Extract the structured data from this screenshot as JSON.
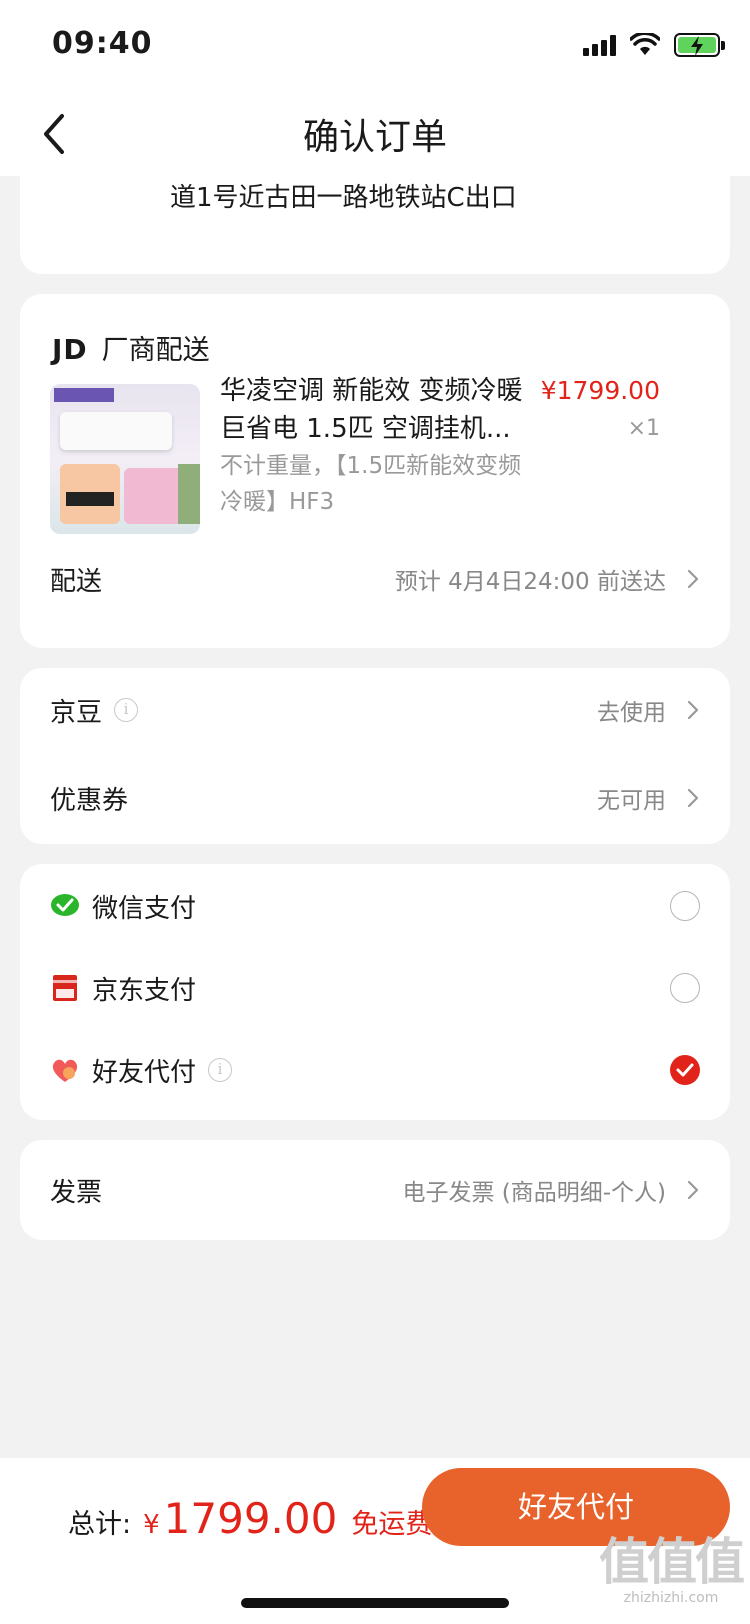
{
  "status_bar": {
    "time": "09:40"
  },
  "nav": {
    "title": "确认订单"
  },
  "address": {
    "text": "道1号近古田一路地铁站C出口"
  },
  "shop": {
    "logo": "JD",
    "name": "厂商配送"
  },
  "product": {
    "title": "华凌空调 新能效 变频冷暖巨省电 1.5匹 空调挂机...",
    "price": "¥1799.00",
    "quantity": "×1",
    "spec": "不计重量，【1.5匹新能效变频冷暖】HF3"
  },
  "delivery": {
    "label": "配送",
    "value": "预计 4月4日24:00 前送达"
  },
  "discounts": {
    "beans": {
      "label": "京豆",
      "value": "去使用"
    },
    "coupon": {
      "label": "优惠券",
      "value": "无可用"
    }
  },
  "payment": {
    "options": [
      {
        "label": "微信支付",
        "icon": "wechat-pay-icon",
        "selected": false
      },
      {
        "label": "京东支付",
        "icon": "jd-pay-icon",
        "selected": false
      },
      {
        "label": "好友代付",
        "icon": "friend-pay-icon",
        "selected": true
      }
    ]
  },
  "invoice": {
    "label": "发票",
    "value": "电子发票 (商品明细-个人)"
  },
  "footer": {
    "total_label": "总计:",
    "currency": "¥",
    "amount": "1799.00",
    "shipping": "免运费",
    "button_label": "好友代付"
  },
  "watermark": {
    "main": "值值值",
    "sub": "zhizhizhi.com"
  },
  "colors": {
    "accent": "#e2231a",
    "button": "#e8632b"
  }
}
